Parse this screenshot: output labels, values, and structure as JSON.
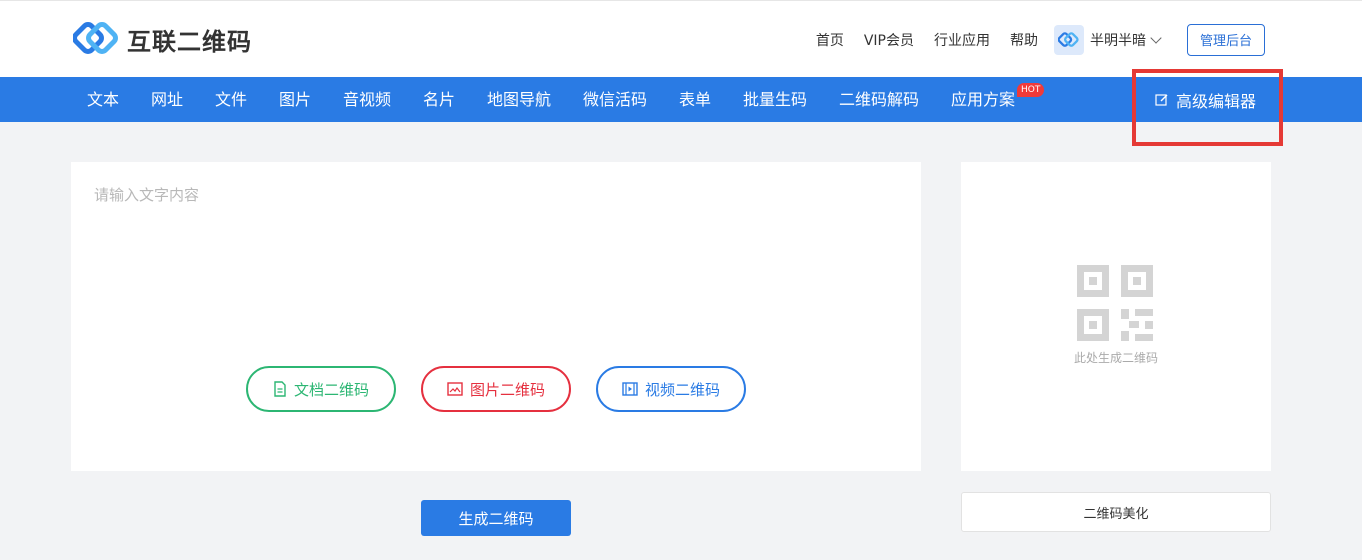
{
  "brand": {
    "logo_text": "互联二维码",
    "accent": "#2a7be4",
    "logo_icon": "logo-icon"
  },
  "topnav": {
    "links": [
      "首页",
      "VIP会员",
      "行业应用",
      "帮助"
    ],
    "user_name": "半明半暗",
    "admin_label": "管理后台"
  },
  "nav": {
    "items": [
      "文本",
      "网址",
      "文件",
      "图片",
      "音视频",
      "名片",
      "地图导航",
      "微信活码",
      "表单",
      "批量生码",
      "二维码解码",
      "应用方案"
    ],
    "hot_badge": "HOT",
    "advanced_editor": "高级编辑器"
  },
  "editor": {
    "placeholder": "请输入文字内容",
    "value": "",
    "doc_button": "文档二维码",
    "image_button": "图片二维码",
    "video_button": "视频二维码",
    "generate_button": "生成二维码"
  },
  "preview": {
    "placeholder_text": "此处生成二维码",
    "beautify_button": "二维码美化"
  },
  "colors": {
    "doc": "#2cb673",
    "image": "#e5303f",
    "video": "#2a7be4",
    "highlight": "#e53935"
  }
}
